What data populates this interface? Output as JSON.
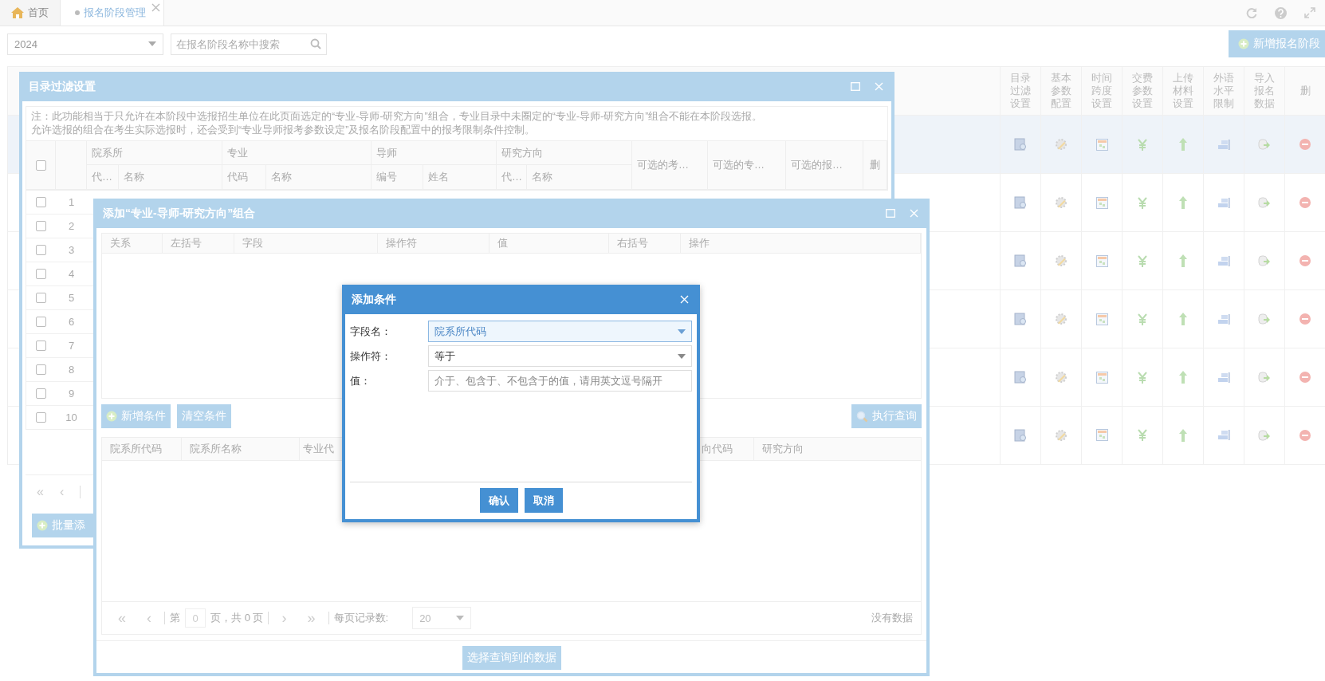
{
  "tabs": [
    {
      "label": "首页",
      "kind": "home",
      "selected": false
    },
    {
      "label": "报名阶段管理",
      "kind": "page",
      "selected": true
    }
  ],
  "toolbar": {
    "year": "2024",
    "search": {
      "placeholder": "在报名阶段名称中搜索"
    },
    "add_button": "新增报名阶段"
  },
  "stage_table": {
    "columns": [
      {
        "label": "目录过滤设置",
        "kind": "filter"
      },
      {
        "label": "基本参数配置",
        "kind": "gear"
      },
      {
        "label": "时间跨度设置",
        "kind": "calendar"
      },
      {
        "label": "交费参数设置",
        "kind": "yen"
      },
      {
        "label": "上传材料设置",
        "kind": "upload"
      },
      {
        "label": "外语水平限制",
        "kind": "bars"
      },
      {
        "label": "导入报名数据",
        "kind": "import"
      },
      {
        "label": "删",
        "kind": "delete"
      }
    ],
    "rows": [
      {
        "selected": true
      },
      {
        "selected": false
      },
      {
        "selected": false
      },
      {
        "selected": false
      },
      {
        "selected": false
      },
      {
        "selected": false
      }
    ]
  },
  "filter_dialog": {
    "title": "目录过滤设置",
    "note": [
      "注：此功能相当于只允许在本阶段中选报招生单位在此页面选定的“专业-导师-研究方向”组合，专业目录中未圈定的“专业-导师-研究方向”组合不能在本阶段选报。",
      "允许选报的组合在考生实际选报时，还会受到“专业导师报考参数设定”及报名阶段配置中的报考限制条件控制。"
    ],
    "groups": [
      {
        "label": "院系所",
        "sub": [
          "代…",
          "名称"
        ]
      },
      {
        "label": "专业",
        "sub": [
          "代码",
          "名称"
        ]
      },
      {
        "label": "导师",
        "sub": [
          "编号",
          "姓名"
        ]
      },
      {
        "label": "研究方向",
        "sub": [
          "代…",
          "名称"
        ]
      }
    ],
    "columns": [
      "可选的考…",
      "可选的专…",
      "可选的报…",
      "删"
    ],
    "header_checked": false,
    "rows": [
      {
        "number": "1",
        "checked": false
      },
      {
        "number": "2",
        "checked": false
      },
      {
        "number": "3",
        "checked": false
      },
      {
        "number": "4",
        "checked": false
      },
      {
        "number": "5",
        "checked": false
      },
      {
        "number": "6",
        "checked": false
      },
      {
        "number": "7",
        "checked": false
      },
      {
        "number": "8",
        "checked": false
      },
      {
        "number": "9",
        "checked": false
      },
      {
        "number": "10",
        "checked": false
      }
    ],
    "pager": [
      "«",
      "‹"
    ],
    "batch_button": "批量添"
  },
  "combo_dialog": {
    "title": "添加“专业-导师-研究方向”组合",
    "condition_columns": [
      "关系",
      "左括号",
      "字段",
      "操作符",
      "值",
      "右括号",
      "操作"
    ],
    "add_condition": "新增条件",
    "clear_conditions": "清空条件",
    "run_query": "执行查询",
    "result_columns": [
      "院系所代码",
      "院系所名称",
      "专业代",
      "向代码",
      "研究方向"
    ],
    "pager": {
      "first": "«",
      "prev": "‹",
      "page_label": "第",
      "page": "0",
      "page_total": "页，共 0 页",
      "next": "›",
      "last": "»",
      "size_label": "每页记录数:",
      "size": "20",
      "status": "没有数据"
    },
    "select_button": "选择查询到的数据"
  },
  "condition_dialog": {
    "title": "添加条件",
    "fields": [
      {
        "label": "字段名：",
        "kind": "select",
        "value": "院系所代码",
        "focused": true
      },
      {
        "label": "操作符：",
        "kind": "select",
        "value": "等于",
        "focused": false
      },
      {
        "label": "值：",
        "kind": "text",
        "placeholder": "介于、包含于、不包含于的值，请用英文逗号隔开"
      }
    ],
    "buttons": [
      "确认",
      "取消"
    ]
  }
}
